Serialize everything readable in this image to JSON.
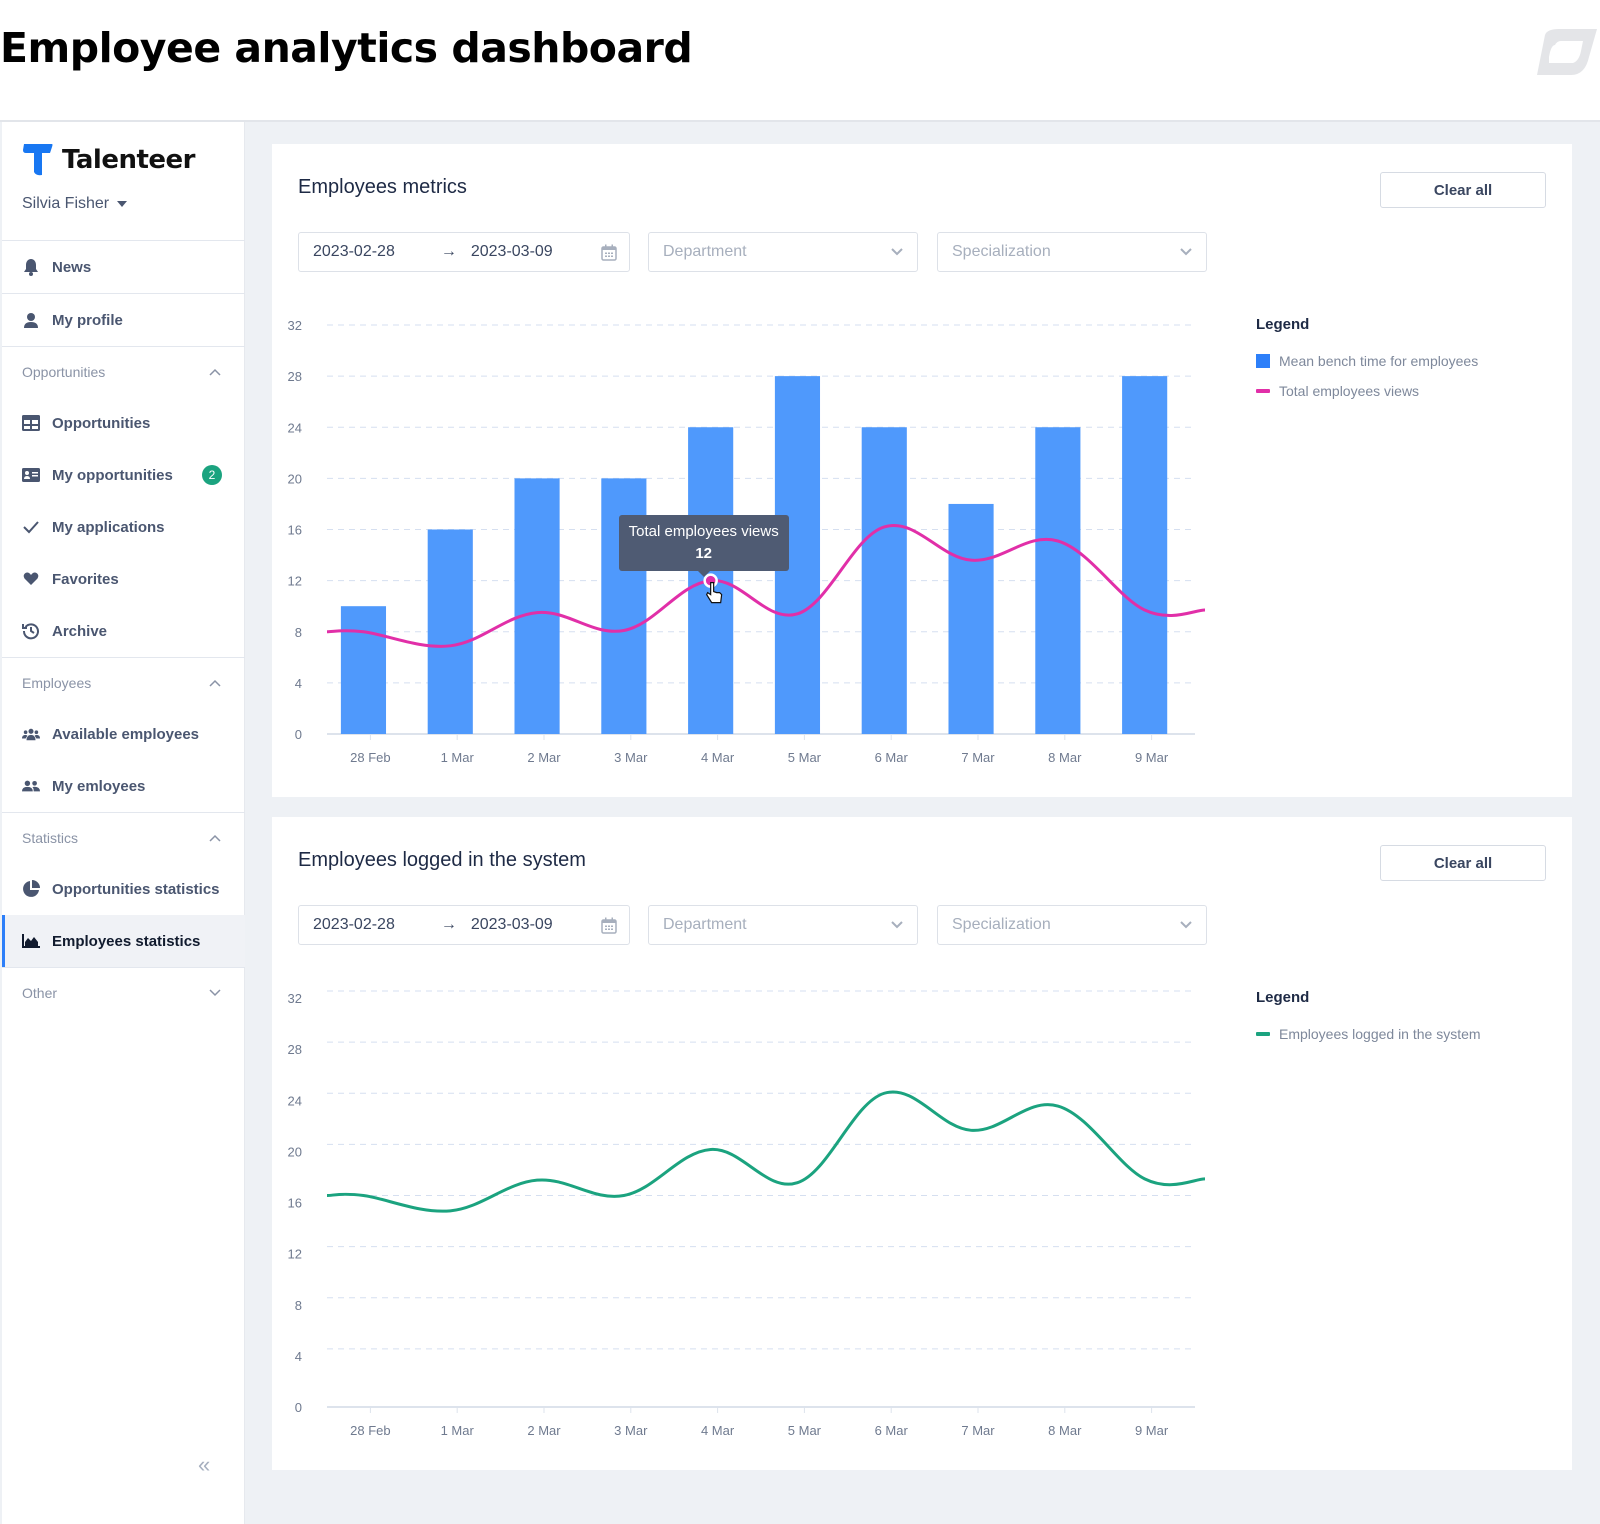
{
  "page": {
    "title": "Employee analytics dashboard"
  },
  "sidebar": {
    "brand": "Talenteer",
    "user_name": "Silvia Fisher",
    "top_items": [
      {
        "label": "News",
        "icon": "bell-icon"
      },
      {
        "label": "My profile",
        "icon": "user-icon"
      }
    ],
    "groups": [
      {
        "label": "Opportunities",
        "expanded": true,
        "items": [
          {
            "label": "Opportunities",
            "icon": "grid-icon"
          },
          {
            "label": "My opportunities",
            "icon": "id-card-icon",
            "badge": "2"
          },
          {
            "label": "My applications",
            "icon": "check-icon"
          },
          {
            "label": "Favorites",
            "icon": "heart-icon"
          },
          {
            "label": "Archive",
            "icon": "history-icon"
          }
        ]
      },
      {
        "label": "Employees",
        "expanded": true,
        "items": [
          {
            "label": "Available employees",
            "icon": "users-group-icon"
          },
          {
            "label": "My emloyees",
            "icon": "users-icon"
          }
        ]
      },
      {
        "label": "Statistics",
        "expanded": true,
        "items": [
          {
            "label": "Opportunities statistics",
            "icon": "pie-chart-icon"
          },
          {
            "label": "Employees statistics",
            "icon": "area-chart-icon",
            "active": true
          }
        ]
      },
      {
        "label": "Other",
        "expanded": false,
        "items": []
      }
    ],
    "collapse_glyph": "«"
  },
  "cards": [
    {
      "title": "Employees metrics",
      "clear_label": "Clear all",
      "date_from": "2023-02-28",
      "date_to": "2023-03-09",
      "date_sep": "→",
      "department_placeholder": "Department",
      "specialization_placeholder": "Specialization",
      "legend_title": "Legend",
      "legend": [
        {
          "label": "Mean bench time for employees",
          "color": "#2d7ff9",
          "kind": "square"
        },
        {
          "label": "Total employees views",
          "color": "#e12fa8",
          "kind": "line"
        }
      ],
      "tooltip": {
        "label": "Total employees views",
        "value": "12",
        "category": "4 Mar"
      }
    },
    {
      "title": "Employees logged in the system",
      "clear_label": "Clear all",
      "date_from": "2023-02-28",
      "date_to": "2023-03-09",
      "date_sep": "→",
      "department_placeholder": "Department",
      "specialization_placeholder": "Specialization",
      "legend_title": "Legend",
      "legend": [
        {
          "label": "Employees logged in the system",
          "color": "#1ba37f",
          "kind": "line"
        }
      ]
    }
  ],
  "chart_data": [
    {
      "type": "bar",
      "title": "Employees metrics",
      "categories": [
        "28 Feb",
        "1 Mar",
        "2 Mar",
        "3 Mar",
        "4 Mar",
        "5 Mar",
        "6 Mar",
        "7 Mar",
        "8 Mar",
        "9 Mar"
      ],
      "yticks": [
        0,
        4,
        8,
        12,
        16,
        20,
        24,
        28,
        32
      ],
      "ylim": [
        0,
        32
      ],
      "grid": true,
      "legend_position": "right",
      "series": [
        {
          "name": "Mean bench time for employees",
          "type": "bar",
          "color": "#4f99fc",
          "values": [
            10,
            16,
            20,
            20,
            24,
            28,
            24,
            18,
            24,
            28
          ]
        },
        {
          "name": "Total employees views",
          "type": "line",
          "smooth": true,
          "color": "#e12fa8",
          "values": [
            8,
            6.9,
            9.5,
            8.1,
            12,
            9.4,
            16.2,
            13.6,
            15.1,
            9.7
          ]
        }
      ],
      "annotation": {
        "series": "Total employees views",
        "category": "4 Mar",
        "value": 12
      }
    },
    {
      "type": "line",
      "title": "Employees logged in the system",
      "categories": [
        "28 Feb",
        "1 Mar",
        "2 Mar",
        "3 Mar",
        "4 Mar",
        "5 Mar",
        "6 Mar",
        "7 Mar",
        "8 Mar",
        "9 Mar"
      ],
      "yticks": [
        0,
        4,
        8,
        12,
        16,
        20,
        24,
        28,
        32
      ],
      "ylim": [
        0,
        32
      ],
      "grid": true,
      "legend_position": "right",
      "series": [
        {
          "name": "Employees logged in the system",
          "type": "line",
          "smooth": true,
          "color": "#1ba37f",
          "values": [
            16,
            14.8,
            17.2,
            16,
            19.6,
            17,
            24,
            21.1,
            23,
            17.3
          ]
        }
      ]
    }
  ]
}
